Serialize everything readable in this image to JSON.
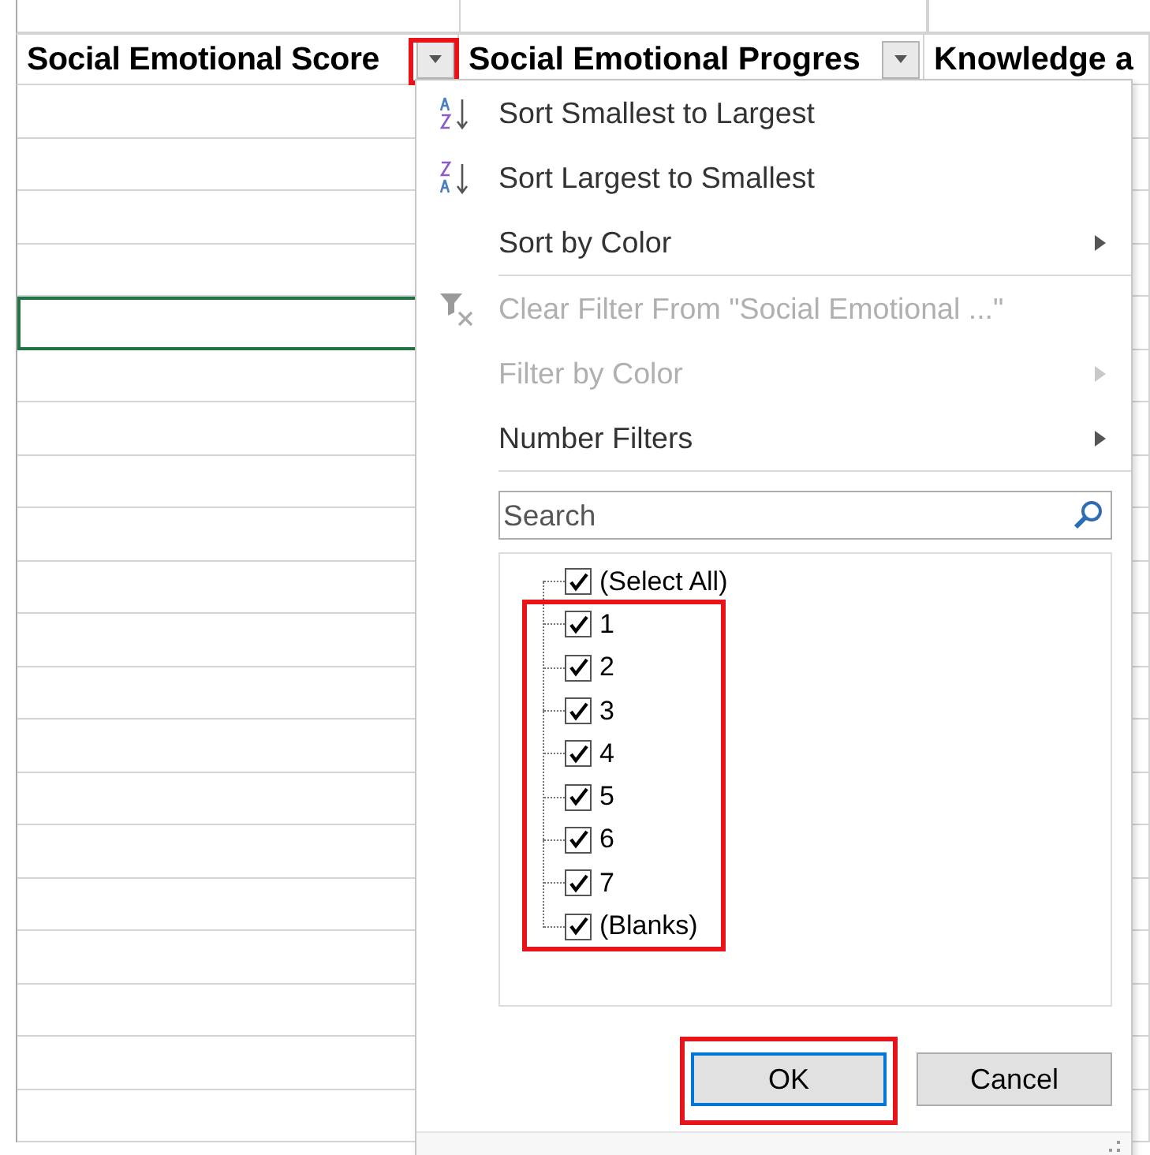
{
  "sheet": {
    "columns": [
      {
        "header": "Social Emotional Score",
        "filter_button": true,
        "highlight": true
      },
      {
        "header": "Social Emotional Progres",
        "filter_button": true,
        "highlight": false
      },
      {
        "header": "Knowledge a",
        "filter_button": false,
        "highlight": false
      }
    ],
    "rows": [
      {
        "selected": false
      },
      {
        "selected": false
      },
      {
        "selected": false
      },
      {
        "selected": false
      },
      {
        "selected": true
      },
      {
        "selected": false
      },
      {
        "selected": false
      },
      {
        "selected": false
      },
      {
        "selected": false
      },
      {
        "selected": false
      },
      {
        "selected": false
      },
      {
        "selected": false
      },
      {
        "selected": false
      },
      {
        "selected": false
      },
      {
        "selected": false
      },
      {
        "selected": false
      },
      {
        "selected": false
      },
      {
        "selected": false
      },
      {
        "selected": false
      },
      {
        "selected": false
      }
    ]
  },
  "filter_menu": {
    "items": [
      {
        "kind": "sort_asc",
        "label": "Sort Smallest to Largest",
        "disabled": false,
        "submenu": false
      },
      {
        "kind": "sort_desc",
        "label": "Sort Largest to Smallest",
        "disabled": false,
        "submenu": false
      },
      {
        "kind": "plain",
        "label": "Sort by Color",
        "disabled": false,
        "submenu": true
      },
      {
        "kind": "separator"
      },
      {
        "kind": "clear",
        "label": "Clear Filter From \"Social Emotional ...\"",
        "disabled": true,
        "submenu": false
      },
      {
        "kind": "plain",
        "label": "Filter by Color",
        "disabled": true,
        "submenu": true
      },
      {
        "kind": "plain",
        "label": "Number Filters",
        "disabled": false,
        "submenu": true
      },
      {
        "kind": "separator"
      }
    ],
    "search": {
      "placeholder": "Search"
    },
    "select_all": {
      "label": "(Select All)",
      "checked": true
    },
    "values_highlight": true,
    "values": [
      {
        "label": "1",
        "checked": true
      },
      {
        "label": "2",
        "checked": true
      },
      {
        "label": "3",
        "checked": true
      },
      {
        "label": "4",
        "checked": true
      },
      {
        "label": "5",
        "checked": true
      },
      {
        "label": "6",
        "checked": true
      },
      {
        "label": "7",
        "checked": true
      },
      {
        "label": "(Blanks)",
        "checked": true
      }
    ],
    "buttons": [
      {
        "label": "OK",
        "default": true,
        "highlight": true
      },
      {
        "label": "Cancel",
        "default": false,
        "highlight": false
      }
    ]
  }
}
